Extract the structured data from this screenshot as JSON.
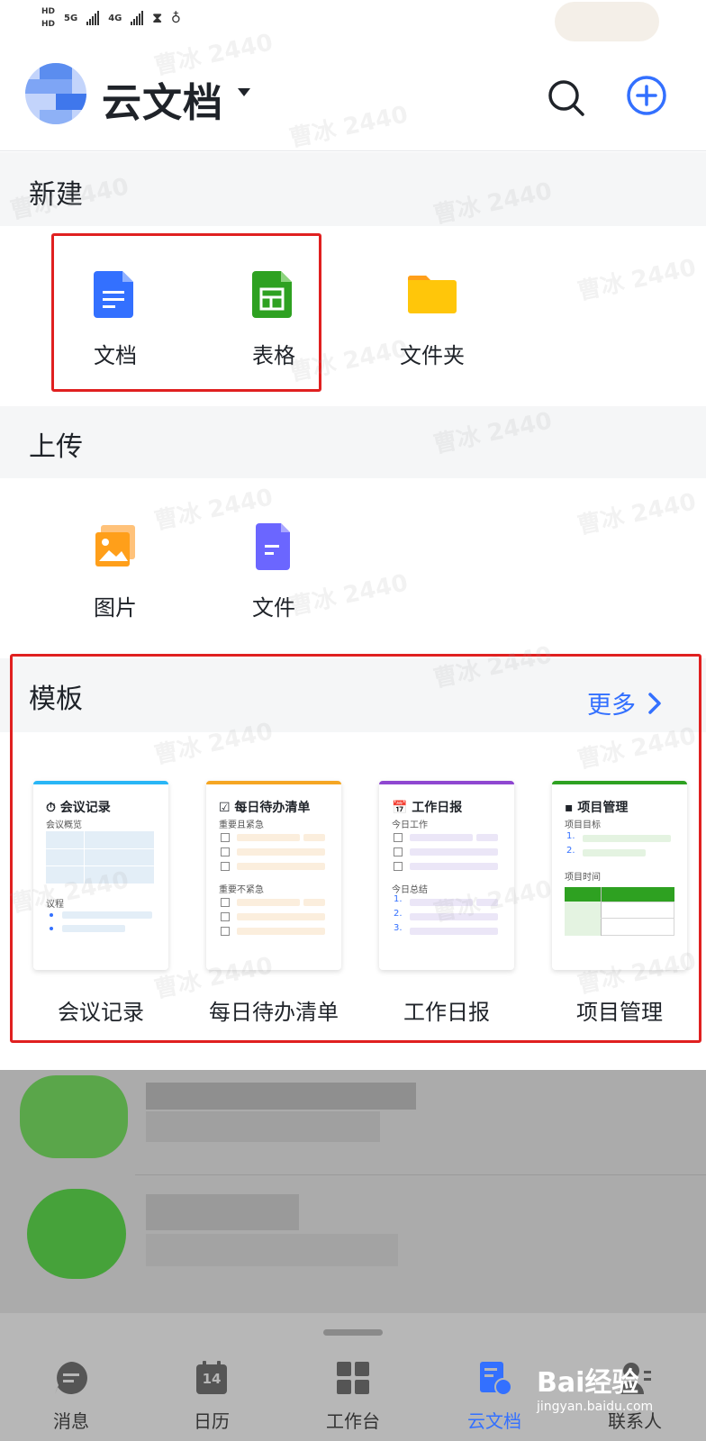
{
  "status_bar": {
    "left_items": [
      "HD",
      "HD",
      "5G",
      "4G"
    ]
  },
  "header": {
    "title": "云文档"
  },
  "new_section": {
    "title": "新建",
    "items": [
      {
        "label": "文档",
        "icon": "doc-icon",
        "color": "#3370ff"
      },
      {
        "label": "表格",
        "icon": "sheet-icon",
        "color": "#2ea121"
      },
      {
        "label": "文件夹",
        "icon": "folder-icon",
        "color": "#ffc60a"
      }
    ]
  },
  "upload_section": {
    "title": "上传",
    "items": [
      {
        "label": "图片",
        "icon": "image-icon",
        "color": "#ff9f1a"
      },
      {
        "label": "文件",
        "icon": "file-icon",
        "color": "#6b66ff"
      }
    ]
  },
  "templates": {
    "title": "模板",
    "more_label": "更多",
    "items": [
      {
        "name": "会议记录",
        "card_title": "⏱ 会议记录",
        "accent": "#29b6f6",
        "sections": [
          "会议概览",
          "议程"
        ]
      },
      {
        "name": "每日待办清单",
        "card_title": "☑ 每日待办清单",
        "accent": "#f5a623",
        "sections": [
          "重要且紧急",
          "重要不紧急"
        ]
      },
      {
        "name": "工作日报",
        "card_title": "📅 工作日报",
        "accent": "#8f47d1",
        "sections": [
          "今日工作",
          "今日总结"
        ]
      },
      {
        "name": "项目管理",
        "card_title": "▪ 项目管理",
        "accent": "#2ea121",
        "sections": [
          "项目目标",
          "项目时间"
        ]
      }
    ]
  },
  "nav": {
    "items": [
      {
        "label": "消息",
        "icon": "message-icon"
      },
      {
        "label": "日历",
        "icon": "calendar-icon",
        "badge": "14"
      },
      {
        "label": "工作台",
        "icon": "workspace-icon"
      },
      {
        "label": "云文档",
        "icon": "cloud-docs-icon",
        "active": true
      },
      {
        "label": "联系人",
        "icon": "contacts-icon"
      }
    ],
    "active_color": "#3370ff"
  },
  "watermark": "曹冰 2440",
  "baidu_watermark": {
    "brand": "Bai经验",
    "url": "jingyan.baidu.com"
  }
}
